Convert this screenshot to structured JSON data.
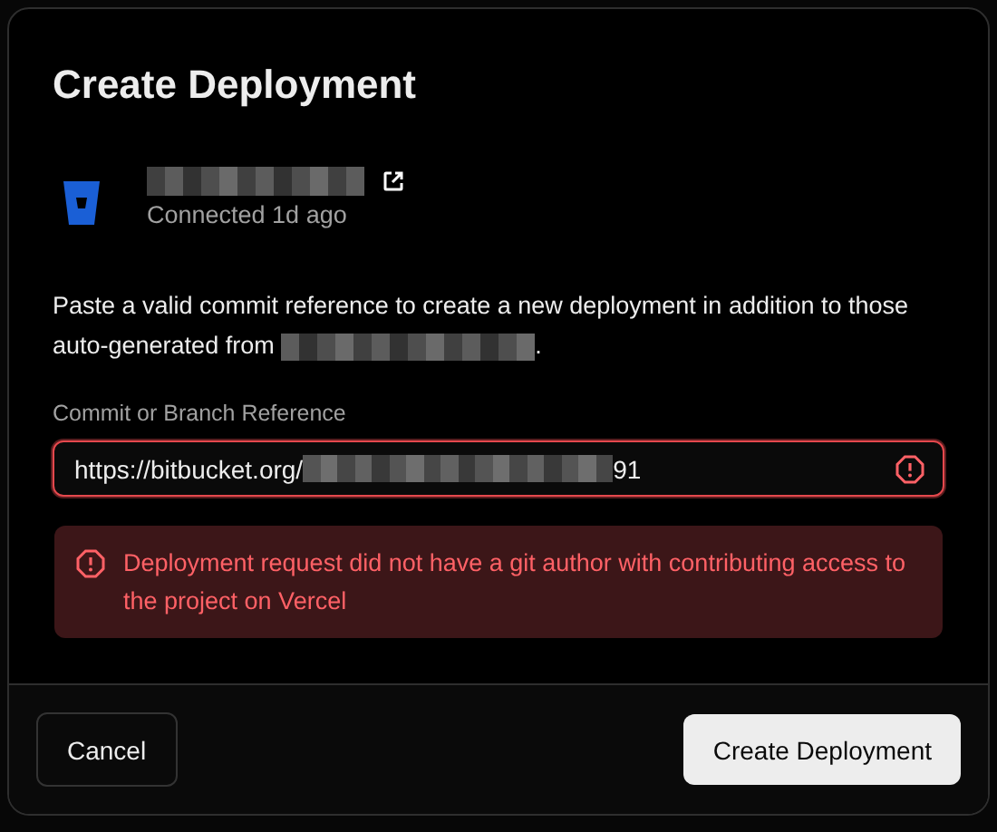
{
  "dialog": {
    "title": "Create Deployment"
  },
  "connection": {
    "status": "Connected 1d ago"
  },
  "description": {
    "text_before": "Paste a valid commit reference to create a new deployment in addition to those auto-generated from",
    "text_after": "."
  },
  "field": {
    "label": "Commit or Branch Reference",
    "value_start": "https://bitbucket.org/",
    "value_end": "91",
    "invalid": true
  },
  "error": {
    "message": "Deployment request did not have a git author with contributing access to the project on Vercel"
  },
  "buttons": [
    {
      "label": "Cancel",
      "kind": "secondary"
    },
    {
      "label": "Create Deployment",
      "kind": "primary"
    }
  ]
}
